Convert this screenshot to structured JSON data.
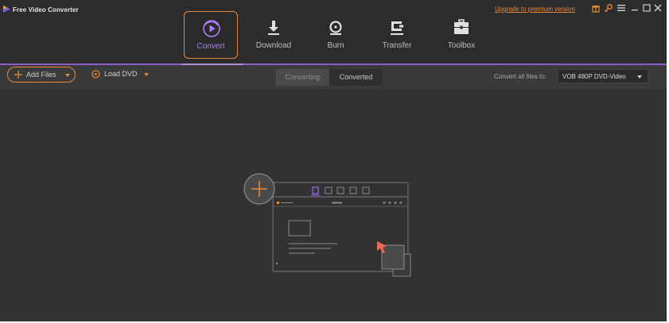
{
  "app": {
    "title": "Free Video Converter"
  },
  "nav": {
    "items": [
      {
        "label": "Convert",
        "icon": "convert-icon",
        "active": true
      },
      {
        "label": "Download",
        "icon": "download-icon",
        "active": false
      },
      {
        "label": "Burn",
        "icon": "burn-icon",
        "active": false
      },
      {
        "label": "Transfer",
        "icon": "transfer-icon",
        "active": false
      },
      {
        "label": "Toolbox",
        "icon": "toolbox-icon",
        "active": false
      }
    ]
  },
  "window_controls": {
    "upgrade_text": "Upgrade to premium version",
    "icons": [
      "gift-icon",
      "key-icon",
      "menu-icon",
      "minimize-icon",
      "maximize-icon",
      "close-icon"
    ]
  },
  "toolbar": {
    "add_files_label": "Add Files",
    "load_dvd_label": "Load DVD",
    "tabs": [
      "Converting",
      "Converted"
    ],
    "active_tab": "Converting",
    "convert_all_label": "Convert all files to:",
    "format_value": "VOB 480P DVD-Video"
  },
  "colors": {
    "accent_orange": "#e8893a",
    "accent_purple": "#8a5cc9",
    "background": "#323232",
    "header": "#2c2c2c"
  }
}
